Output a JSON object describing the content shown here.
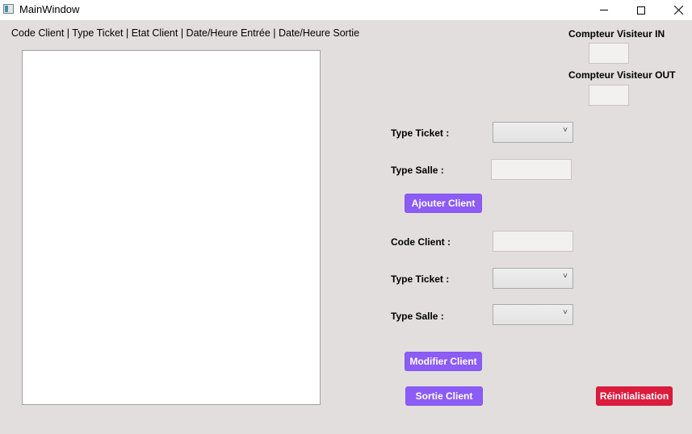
{
  "window": {
    "title": "MainWindow"
  },
  "list": {
    "header": "Code Client | Type Ticket | Etat Client | Date/Heure Entrée | Date/Heure Sortie"
  },
  "counters": {
    "in_label": "Compteur Visiteur IN",
    "in_value": "",
    "out_label": "Compteur Visiteur OUT",
    "out_value": ""
  },
  "add_form": {
    "type_ticket_label": "Type Ticket :",
    "type_ticket_value": "",
    "type_salle_label": "Type Salle :",
    "type_salle_value": "",
    "add_button": "Ajouter Client"
  },
  "edit_form": {
    "code_client_label": "Code Client :",
    "code_client_value": "",
    "type_ticket_label": "Type Ticket :",
    "type_ticket_value": "",
    "type_salle_label": "Type Salle :",
    "type_salle_value": "",
    "modify_button": "Modifier Client",
    "exit_button": "Sortie Client",
    "reset_button": "Réinitialisation"
  },
  "colors": {
    "window_bg": "#e3dede",
    "primary_button": "#8c5cf6",
    "danger_button": "#dc1c3c"
  },
  "icons": {
    "app": "window-app-icon",
    "minimize": "minimize-icon",
    "maximize": "maximize-icon",
    "close": "close-icon",
    "dropdown": "chevron-down-icon"
  }
}
